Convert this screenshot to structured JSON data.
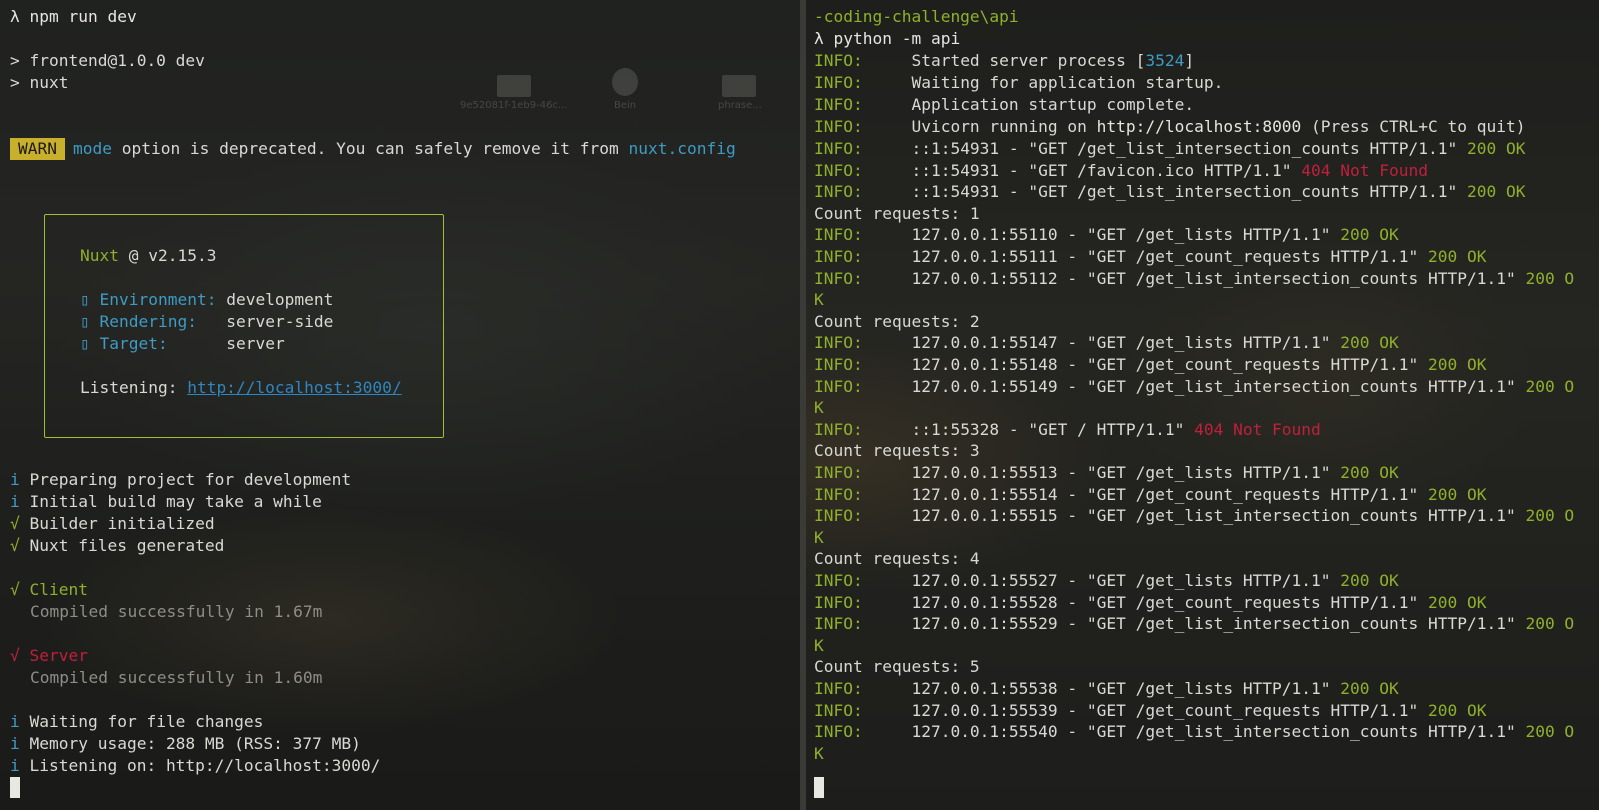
{
  "left_pane": {
    "prompt_cmd": "λ npm run dev",
    "script_header": "> frontend@1.0.0 dev",
    "script_cmd": "> nuxt",
    "warn": {
      "badge": "WARN",
      "word_mode": "mode",
      "text": " option is deprecated. You can safely remove it from ",
      "config": "nuxt.config"
    },
    "nuxt_box": {
      "name": "Nuxt",
      "version": " @ v2.15.3",
      "rows": [
        {
          "icon": "▯",
          "key": "Environment:",
          "value": "development"
        },
        {
          "icon": "▯",
          "key": "Rendering:",
          "value": "server-side"
        },
        {
          "icon": "▯",
          "key": "Target:",
          "value": "server"
        }
      ],
      "listening_label": "Listening: ",
      "listening_url": "http://localhost:3000/"
    },
    "info": [
      {
        "mark": "i",
        "text": "Preparing project for development"
      },
      {
        "mark": "i",
        "text": "Initial build may take a while"
      },
      {
        "mark": "√",
        "text": "Builder initialized"
      },
      {
        "mark": "√",
        "text": "Nuxt files generated"
      }
    ],
    "client": {
      "mark": "√",
      "label": "Client",
      "detail": "Compiled successfully in 1.67m"
    },
    "server": {
      "mark": "√",
      "label": "Server",
      "detail": "Compiled successfully in 1.60m"
    },
    "footer": [
      {
        "mark": "i",
        "text": "Waiting for file changes"
      },
      {
        "mark": "i",
        "text": "Memory usage: 288 MB (RSS: 377 MB)"
      },
      {
        "mark": "i",
        "text": "Listening on: http://localhost:3000/"
      }
    ],
    "desktop_labels": [
      "9e52081f-1eb9-46c...",
      "Bein",
      "phrase..."
    ]
  },
  "right_pane": {
    "path": "-coding-challenge\\api",
    "prompt_cmd": "λ python -m api",
    "startup": [
      {
        "level": "INFO:",
        "text": "     Started server process [",
        "num": "3524",
        "tail": "]"
      },
      {
        "level": "INFO:",
        "text": "     Waiting for application startup."
      },
      {
        "level": "INFO:",
        "text": "     Application startup complete."
      },
      {
        "level": "INFO:",
        "text": "     Uvicorn running on ",
        "url": "http://localhost:8000",
        "tail": " (Press CTRL+C to quit)"
      }
    ],
    "log": [
      {
        "kind": "req",
        "level": "INFO:",
        "text": "     ::1:54931 - \"GET /get_list_intersection_counts HTTP/1.1\" ",
        "status": "200 OK",
        "ok": true
      },
      {
        "kind": "req",
        "level": "INFO:",
        "text": "     ::1:54931 - \"GET /favicon.ico HTTP/1.1\" ",
        "status": "404 Not Found",
        "ok": false
      },
      {
        "kind": "req",
        "level": "INFO:",
        "text": "     ::1:54931 - \"GET /get_list_intersection_counts HTTP/1.1\" ",
        "status": "200 OK",
        "ok": true
      },
      {
        "kind": "count",
        "text": "Count requests: 1"
      },
      {
        "kind": "req",
        "level": "INFO:",
        "text": "     127.0.0.1:55110 - \"GET /get_lists HTTP/1.1\" ",
        "status": "200 OK",
        "ok": true
      },
      {
        "kind": "req",
        "level": "INFO:",
        "text": "     127.0.0.1:55111 - \"GET /get_count_requests HTTP/1.1\" ",
        "status": "200 OK",
        "ok": true
      },
      {
        "kind": "req",
        "level": "INFO:",
        "text": "     127.0.0.1:55112 - \"GET /get_list_intersection_counts HTTP/1.1\" ",
        "status": "200 O",
        "ok": true
      },
      {
        "kind": "wrap",
        "text": "K"
      },
      {
        "kind": "count",
        "text": "Count requests: 2"
      },
      {
        "kind": "req",
        "level": "INFO:",
        "text": "     127.0.0.1:55147 - \"GET /get_lists HTTP/1.1\" ",
        "status": "200 OK",
        "ok": true
      },
      {
        "kind": "req",
        "level": "INFO:",
        "text": "     127.0.0.1:55148 - \"GET /get_count_requests HTTP/1.1\" ",
        "status": "200 OK",
        "ok": true
      },
      {
        "kind": "req",
        "level": "INFO:",
        "text": "     127.0.0.1:55149 - \"GET /get_list_intersection_counts HTTP/1.1\" ",
        "status": "200 O",
        "ok": true
      },
      {
        "kind": "wrap",
        "text": "K"
      },
      {
        "kind": "req",
        "level": "INFO:",
        "text": "     ::1:55328 - \"GET / HTTP/1.1\" ",
        "status": "404 Not Found",
        "ok": false
      },
      {
        "kind": "count",
        "text": "Count requests: 3"
      },
      {
        "kind": "req",
        "level": "INFO:",
        "text": "     127.0.0.1:55513 - \"GET /get_lists HTTP/1.1\" ",
        "status": "200 OK",
        "ok": true
      },
      {
        "kind": "req",
        "level": "INFO:",
        "text": "     127.0.0.1:55514 - \"GET /get_count_requests HTTP/1.1\" ",
        "status": "200 OK",
        "ok": true
      },
      {
        "kind": "req",
        "level": "INFO:",
        "text": "     127.0.0.1:55515 - \"GET /get_list_intersection_counts HTTP/1.1\" ",
        "status": "200 O",
        "ok": true
      },
      {
        "kind": "wrap",
        "text": "K"
      },
      {
        "kind": "count",
        "text": "Count requests: 4"
      },
      {
        "kind": "req",
        "level": "INFO:",
        "text": "     127.0.0.1:55527 - \"GET /get_lists HTTP/1.1\" ",
        "status": "200 OK",
        "ok": true
      },
      {
        "kind": "req",
        "level": "INFO:",
        "text": "     127.0.0.1:55528 - \"GET /get_count_requests HTTP/1.1\" ",
        "status": "200 OK",
        "ok": true
      },
      {
        "kind": "req",
        "level": "INFO:",
        "text": "     127.0.0.1:55529 - \"GET /get_list_intersection_counts HTTP/1.1\" ",
        "status": "200 O",
        "ok": true
      },
      {
        "kind": "wrap",
        "text": "K"
      },
      {
        "kind": "count",
        "text": "Count requests: 5"
      },
      {
        "kind": "req",
        "level": "INFO:",
        "text": "     127.0.0.1:55538 - \"GET /get_lists HTTP/1.1\" ",
        "status": "200 OK",
        "ok": true
      },
      {
        "kind": "req",
        "level": "INFO:",
        "text": "     127.0.0.1:55539 - \"GET /get_count_requests HTTP/1.1\" ",
        "status": "200 OK",
        "ok": true
      },
      {
        "kind": "req",
        "level": "INFO:",
        "text": "     127.0.0.1:55540 - \"GET /get_list_intersection_counts HTTP/1.1\" ",
        "status": "200 O",
        "ok": true
      },
      {
        "kind": "wrap",
        "text": "K"
      }
    ]
  },
  "colors": {
    "green": "#8fb02b",
    "cyan": "#3e9bc4",
    "red": "#c0203c",
    "warn_bg": "#c9b02c"
  }
}
